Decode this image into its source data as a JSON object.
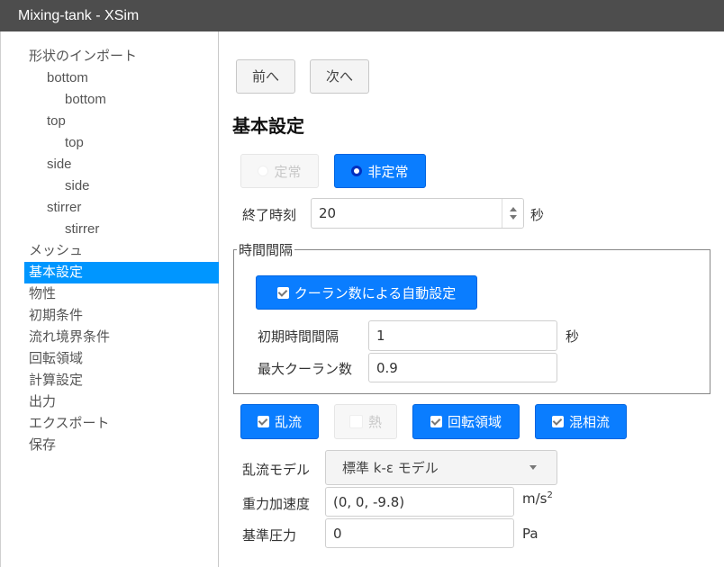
{
  "window": {
    "title": "Mixing-tank - XSim"
  },
  "sidebar": {
    "items": [
      {
        "label": "形状のインポート",
        "level": 0
      },
      {
        "label": "bottom",
        "level": 1
      },
      {
        "label": "bottom",
        "level": 2
      },
      {
        "label": "top",
        "level": 1
      },
      {
        "label": "top",
        "level": 2
      },
      {
        "label": "side",
        "level": 1
      },
      {
        "label": "side",
        "level": 2
      },
      {
        "label": "stirrer",
        "level": 1
      },
      {
        "label": "stirrer",
        "level": 2
      },
      {
        "label": "メッシュ",
        "level": 0
      },
      {
        "label": "基本設定",
        "level": 0,
        "active": true
      },
      {
        "label": "物性",
        "level": 0
      },
      {
        "label": "初期条件",
        "level": 0
      },
      {
        "label": "流れ境界条件",
        "level": 0
      },
      {
        "label": "回転領域",
        "level": 0
      },
      {
        "label": "計算設定",
        "level": 0
      },
      {
        "label": "出力",
        "level": 0
      },
      {
        "label": "エクスポート",
        "level": 0
      },
      {
        "label": "保存",
        "level": 0
      }
    ]
  },
  "nav": {
    "prev_label": "前へ",
    "next_label": "次へ"
  },
  "page_title": "基本設定",
  "time_mode": {
    "steady_label": "定常",
    "unsteady_label": "非定常",
    "selected": "非定常"
  },
  "end_time": {
    "label": "終了時刻",
    "value": "20",
    "unit": "秒"
  },
  "time_step": {
    "legend": "時間間隔",
    "auto_label": "クーラン数による自動設定",
    "auto_checked": true,
    "initial_label": "初期時間間隔",
    "initial_value": "1",
    "initial_unit": "秒",
    "max_courant_label": "最大クーラン数",
    "max_courant_value": "0.9"
  },
  "toggles": {
    "turbulence": {
      "label": "乱流",
      "checked": true
    },
    "heat": {
      "label": "熱",
      "checked": false,
      "disabled": true
    },
    "rotating": {
      "label": "回転領域",
      "checked": true
    },
    "multiphase": {
      "label": "混相流",
      "checked": true
    }
  },
  "turbulence_model": {
    "label": "乱流モデル",
    "value": "標準 k-ε モデル"
  },
  "gravity": {
    "label": "重力加速度",
    "value": "(0, 0, -9.8)",
    "unit": "m/s",
    "unit_sup": "2"
  },
  "ref_pressure": {
    "label": "基準圧力",
    "value": "0",
    "unit": "Pa"
  }
}
